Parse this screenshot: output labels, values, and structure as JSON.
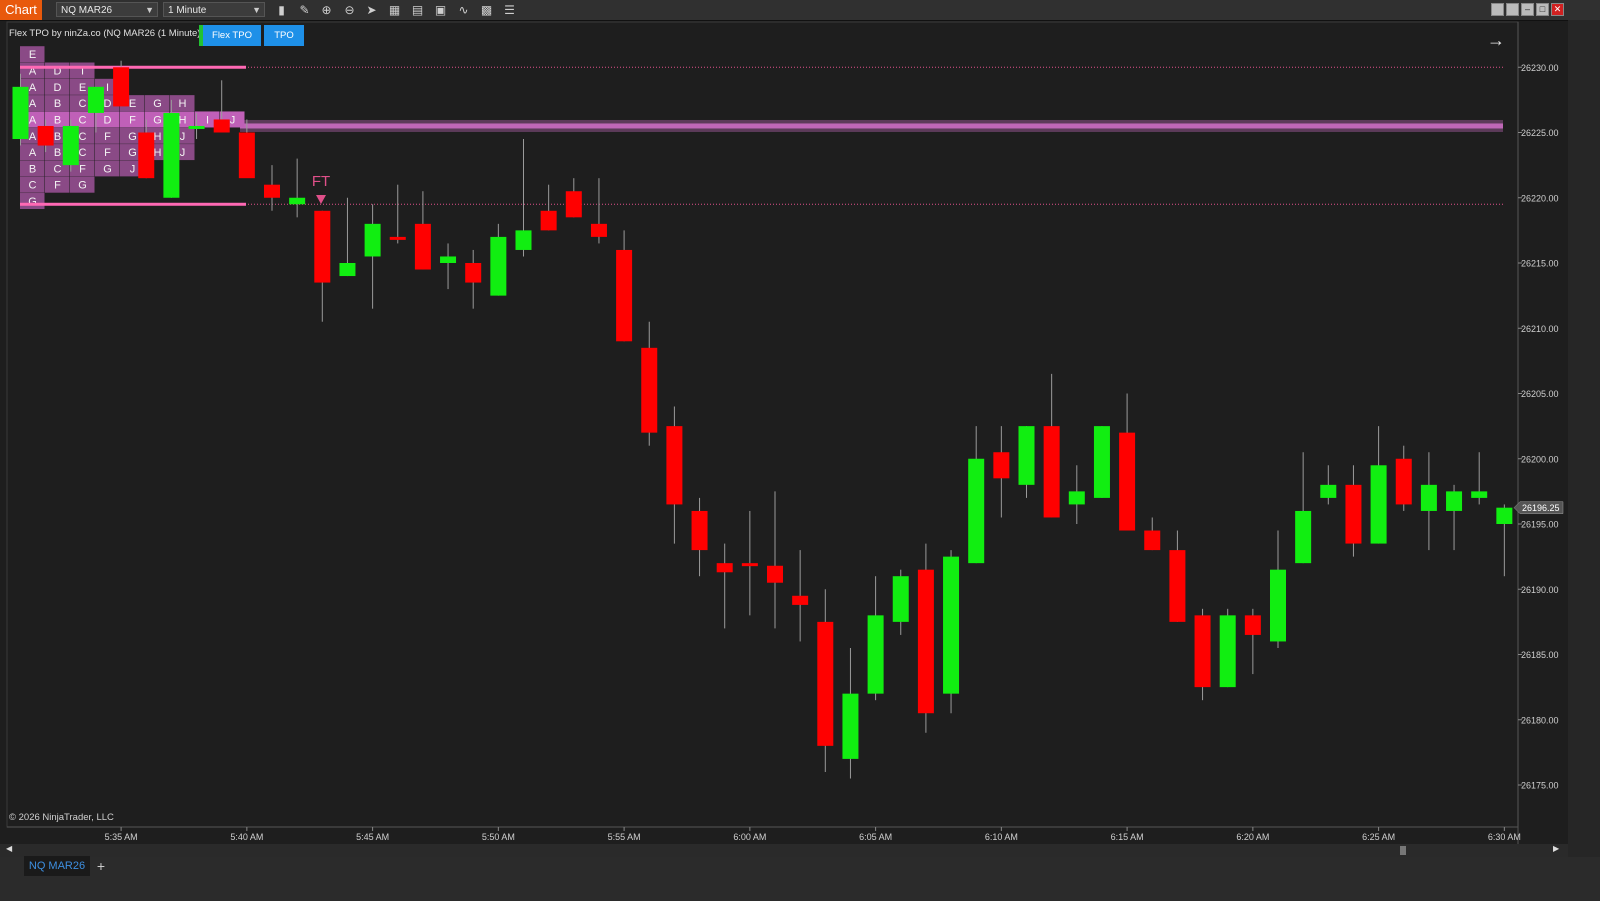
{
  "toolbar": {
    "chart_button": "Chart",
    "instrument": "NQ MAR26",
    "interval": "1 Minute",
    "icons": [
      "bar-type-icon",
      "drawing-tool-icon",
      "zoom-in-icon",
      "zoom-out-icon",
      "pointer-icon",
      "data-box-icon",
      "properties-icon",
      "snapshot-icon",
      "strategies-icon",
      "indicators-icon",
      "templates-icon"
    ],
    "window_buttons": [
      "tile-icon",
      "restore-icon",
      "minimize-icon",
      "maximize-icon",
      "close-icon"
    ]
  },
  "indicator": {
    "label": "Flex TPO by ninZa.co (NQ MAR26 (1 Minute))",
    "button_flex": "Flex TPO",
    "button_tpo": "TPO"
  },
  "annotation": {
    "label": "FT"
  },
  "copyright": "© 2026 NinjaTrader, LLC",
  "tabs": {
    "active": "NQ MAR26",
    "add": "+"
  },
  "colors": {
    "up": "#11ee11",
    "down": "#ff0000",
    "tpo_fill": "#8a4a86",
    "tpo_poc_fill": "#c060b8",
    "value_area_line": "#ff69b4",
    "poc_band": "#d070c8",
    "background": "#1e1e1e",
    "price_marker": "#555555"
  },
  "chart_data": {
    "type": "candlestick",
    "instrument": "NQ MAR26",
    "interval": "1 Minute",
    "y_axis_ticks": [
      "26230.00",
      "26225.00",
      "26220.00",
      "26215.00",
      "26210.00",
      "26205.00",
      "26200.00",
      "26195.00",
      "26190.00",
      "26185.00",
      "26180.00",
      "26175.00"
    ],
    "ylim": [
      26172.2,
      26233.4
    ],
    "x_axis_ticks": [
      "5:35 AM",
      "5:40 AM",
      "5:45 AM",
      "5:50 AM",
      "5:55 AM",
      "6:00 AM",
      "6:05 AM",
      "6:10 AM",
      "6:15 AM",
      "6:20 AM",
      "6:25 AM",
      "6:30 AM"
    ],
    "last_price": "26196.25",
    "horizontal_levels": [
      {
        "price": 26230.0,
        "style": "dotted"
      },
      {
        "price": 26225.5,
        "style": "band"
      },
      {
        "price": 26219.5,
        "style": "dotted"
      }
    ],
    "tpo_profile": {
      "rows": [
        {
          "price": 26231.0,
          "letters": [
            "E"
          ]
        },
        {
          "price": 26229.75,
          "letters": [
            "A",
            "D",
            "I"
          ]
        },
        {
          "price": 26228.5,
          "letters": [
            "A",
            "D",
            "E",
            "I"
          ]
        },
        {
          "price": 26227.25,
          "letters": [
            "A",
            "B",
            "C",
            "D",
            "E",
            "G",
            "H"
          ]
        },
        {
          "price": 26226.0,
          "letters": [
            "A",
            "B",
            "C",
            "D",
            "F",
            "G",
            "H",
            "I",
            "J"
          ],
          "poc": true
        },
        {
          "price": 26224.75,
          "letters": [
            "A",
            "B",
            "C",
            "F",
            "G",
            "H",
            "J"
          ]
        },
        {
          "price": 26223.5,
          "letters": [
            "A",
            "B",
            "C",
            "F",
            "G",
            "H",
            "J"
          ]
        },
        {
          "price": 26222.25,
          "letters": [
            "B",
            "C",
            "F",
            "G",
            "J"
          ]
        },
        {
          "price": 26221.0,
          "letters": [
            "C",
            "F",
            "G"
          ]
        },
        {
          "price": 26219.75,
          "letters": [
            "G"
          ]
        }
      ],
      "value_area_high": 26230.0,
      "value_area_low": 26219.5
    },
    "candles": [
      {
        "time": "5:31 AM",
        "open": 26224.5,
        "high": 26229.5,
        "low": 26224.0,
        "close": 26228.5
      },
      {
        "time": "5:32 AM",
        "open": 26225.5,
        "high": 26226.0,
        "low": 26223.5,
        "close": 26224.0
      },
      {
        "time": "5:33 AM",
        "open": 26222.5,
        "high": 26226.0,
        "low": 26222.0,
        "close": 26225.5
      },
      {
        "time": "5:34 AM",
        "open": 26226.5,
        "high": 26228.5,
        "low": 26225.0,
        "close": 26228.5
      },
      {
        "time": "5:35 AM",
        "open": 26230.0,
        "high": 26230.5,
        "low": 26227.0,
        "close": 26227.0
      },
      {
        "time": "5:36 AM",
        "open": 26225.0,
        "high": 26226.0,
        "low": 26221.5,
        "close": 26221.5
      },
      {
        "time": "5:37 AM",
        "open": 26220.0,
        "high": 26227.5,
        "low": 26220.0,
        "close": 26226.5
      },
      {
        "time": "5:38 AM",
        "open": 26225.5,
        "high": 26226.5,
        "low": 26224.5,
        "close": 26225.5
      },
      {
        "time": "5:39 AM",
        "open": 26226.0,
        "high": 26229.0,
        "low": 26225.0,
        "close": 26225.0
      },
      {
        "time": "5:40 AM",
        "open": 26225.0,
        "high": 26226.0,
        "low": 26222.0,
        "close": 26221.5
      },
      {
        "time": "5:41 AM",
        "open": 26221.0,
        "high": 26222.5,
        "low": 26219.0,
        "close": 26220.0
      },
      {
        "time": "5:42 AM",
        "open": 26219.5,
        "high": 26223.0,
        "low": 26218.5,
        "close": 26220.0
      },
      {
        "time": "5:43 AM",
        "open": 26219.0,
        "high": 26219.0,
        "low": 26210.5,
        "close": 26213.5
      },
      {
        "time": "5:44 AM",
        "open": 26214.0,
        "high": 26220.0,
        "low": 26214.0,
        "close": 26215.0
      },
      {
        "time": "5:45 AM",
        "open": 26215.5,
        "high": 26219.5,
        "low": 26211.5,
        "close": 26218.0
      },
      {
        "time": "5:46 AM",
        "open": 26217.0,
        "high": 26221.0,
        "low": 26216.5,
        "close": 26216.8
      },
      {
        "time": "5:47 AM",
        "open": 26218.0,
        "high": 26220.5,
        "low": 26214.5,
        "close": 26214.5
      },
      {
        "time": "5:48 AM",
        "open": 26215.0,
        "high": 26216.5,
        "low": 26213.0,
        "close": 26215.5
      },
      {
        "time": "5:49 AM",
        "open": 26215.0,
        "high": 26216.0,
        "low": 26211.5,
        "close": 26213.5
      },
      {
        "time": "5:50 AM",
        "open": 26212.5,
        "high": 26218.0,
        "low": 26212.5,
        "close": 26217.0
      },
      {
        "time": "5:51 AM",
        "open": 26216.0,
        "high": 26224.5,
        "low": 26215.5,
        "close": 26217.5
      },
      {
        "time": "5:52 AM",
        "open": 26219.0,
        "high": 26221.0,
        "low": 26217.5,
        "close": 26217.5
      },
      {
        "time": "5:53 AM",
        "open": 26220.5,
        "high": 26221.5,
        "low": 26218.5,
        "close": 26218.5
      },
      {
        "time": "5:54 AM",
        "open": 26218.0,
        "high": 26221.5,
        "low": 26216.5,
        "close": 26217.0
      },
      {
        "time": "5:55 AM",
        "open": 26216.0,
        "high": 26217.5,
        "low": 26209.0,
        "close": 26209.0
      },
      {
        "time": "5:56 AM",
        "open": 26208.5,
        "high": 26210.5,
        "low": 26201.0,
        "close": 26202.0
      },
      {
        "time": "5:57 AM",
        "open": 26202.5,
        "high": 26204.0,
        "low": 26193.5,
        "close": 26196.5
      },
      {
        "time": "5:58 AM",
        "open": 26196.0,
        "high": 26197.0,
        "low": 26191.0,
        "close": 26193.0
      },
      {
        "time": "5:59 AM",
        "open": 26192.0,
        "high": 26193.5,
        "low": 26187.0,
        "close": 26191.3
      },
      {
        "time": "6:00 AM",
        "open": 26192.0,
        "high": 26196.0,
        "low": 26188.0,
        "close": 26191.8
      },
      {
        "time": "6:01 AM",
        "open": 26191.8,
        "high": 26197.5,
        "low": 26187.0,
        "close": 26190.5
      },
      {
        "time": "6:02 AM",
        "open": 26189.5,
        "high": 26193.0,
        "low": 26186.0,
        "close": 26188.8
      },
      {
        "time": "6:03 AM",
        "open": 26187.5,
        "high": 26190.0,
        "low": 26176.0,
        "close": 26178.0
      },
      {
        "time": "6:04 AM",
        "open": 26177.0,
        "high": 26185.5,
        "low": 26175.5,
        "close": 26182.0
      },
      {
        "time": "6:05 AM",
        "open": 26182.0,
        "high": 26191.0,
        "low": 26181.5,
        "close": 26188.0
      },
      {
        "time": "6:06 AM",
        "open": 26187.5,
        "high": 26191.5,
        "low": 26186.5,
        "close": 26191.0
      },
      {
        "time": "6:07 AM",
        "open": 26191.5,
        "high": 26193.5,
        "low": 26179.0,
        "close": 26180.5
      },
      {
        "time": "6:08 AM",
        "open": 26182.0,
        "high": 26193.0,
        "low": 26180.5,
        "close": 26192.5
      },
      {
        "time": "6:09 AM",
        "open": 26192.0,
        "high": 26202.5,
        "low": 26192.0,
        "close": 26200.0
      },
      {
        "time": "6:10 AM",
        "open": 26200.5,
        "high": 26202.5,
        "low": 26195.5,
        "close": 26198.5
      },
      {
        "time": "6:11 AM",
        "open": 26198.0,
        "high": 26202.5,
        "low": 26197.0,
        "close": 26202.5
      },
      {
        "time": "6:12 AM",
        "open": 26202.5,
        "high": 26206.5,
        "low": 26195.5,
        "close": 26195.5
      },
      {
        "time": "6:13 AM",
        "open": 26196.5,
        "high": 26199.5,
        "low": 26195.0,
        "close": 26197.5
      },
      {
        "time": "6:14 AM",
        "open": 26197.0,
        "high": 26202.5,
        "low": 26197.0,
        "close": 26202.5
      },
      {
        "time": "6:15 AM",
        "open": 26202.0,
        "high": 26205.0,
        "low": 26194.5,
        "close": 26194.5
      },
      {
        "time": "6:16 AM",
        "open": 26194.5,
        "high": 26195.5,
        "low": 26193.0,
        "close": 26193.0
      },
      {
        "time": "6:17 AM",
        "open": 26193.0,
        "high": 26194.5,
        "low": 26187.5,
        "close": 26187.5
      },
      {
        "time": "6:18 AM",
        "open": 26188.0,
        "high": 26188.5,
        "low": 26181.5,
        "close": 26182.5
      },
      {
        "time": "6:19 AM",
        "open": 26182.5,
        "high": 26188.5,
        "low": 26182.5,
        "close": 26188.0
      },
      {
        "time": "6:20 AM",
        "open": 26188.0,
        "high": 26188.5,
        "low": 26183.5,
        "close": 26186.5
      },
      {
        "time": "6:21 AM",
        "open": 26186.0,
        "high": 26194.5,
        "low": 26185.5,
        "close": 26191.5
      },
      {
        "time": "6:22 AM",
        "open": 26192.0,
        "high": 26200.5,
        "low": 26192.0,
        "close": 26196.0
      },
      {
        "time": "6:23 AM",
        "open": 26197.0,
        "high": 26199.5,
        "low": 26196.5,
        "close": 26198.0
      },
      {
        "time": "6:24 AM",
        "open": 26198.0,
        "high": 26199.5,
        "low": 26192.5,
        "close": 26193.5
      },
      {
        "time": "6:25 AM",
        "open": 26193.5,
        "high": 26202.5,
        "low": 26193.5,
        "close": 26199.5
      },
      {
        "time": "6:26 AM",
        "open": 26200.0,
        "high": 26201.0,
        "low": 26196.0,
        "close": 26196.5
      },
      {
        "time": "6:27 AM",
        "open": 26196.0,
        "high": 26200.5,
        "low": 26193.0,
        "close": 26198.0
      },
      {
        "time": "6:28 AM",
        "open": 26196.0,
        "high": 26198.0,
        "low": 26193.0,
        "close": 26197.5
      },
      {
        "time": "6:29 AM",
        "open": 26197.0,
        "high": 26200.5,
        "low": 26196.5,
        "close": 26197.5
      },
      {
        "time": "6:30 AM",
        "open": 26195.0,
        "high": 26196.5,
        "low": 26191.0,
        "close": 26196.25
      }
    ]
  }
}
